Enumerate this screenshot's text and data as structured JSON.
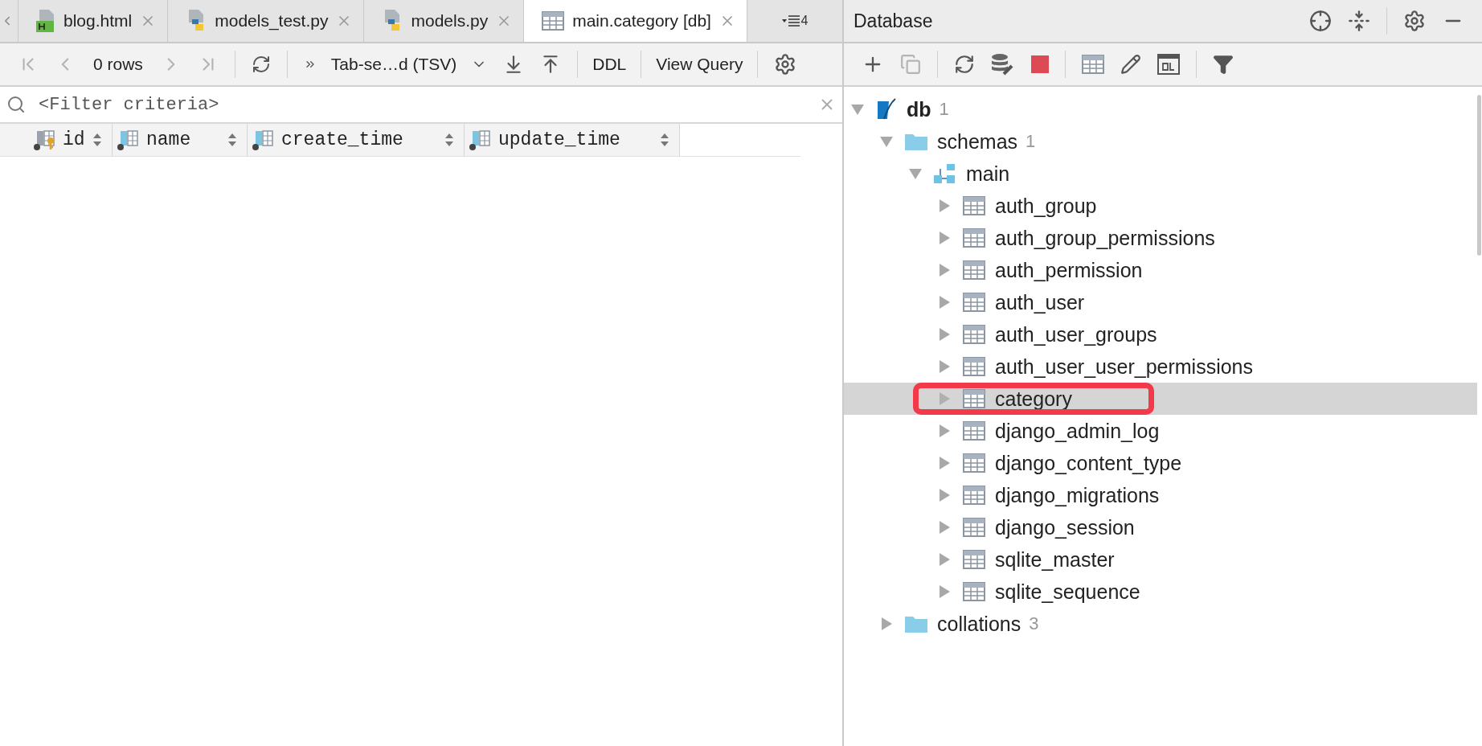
{
  "editor_tabs": [
    {
      "label": "blog.html",
      "kind": "html",
      "selected": false
    },
    {
      "label": "models_test.py",
      "kind": "python",
      "selected": false
    },
    {
      "label": "models.py",
      "kind": "python",
      "selected": false
    },
    {
      "label": "main.category [db]",
      "kind": "table",
      "selected": true
    }
  ],
  "overflow_count": "4",
  "result_toolbar": {
    "rows": "0 rows",
    "format": "Tab-se…d (TSV)",
    "buttons": [
      "DDL",
      "View Query"
    ]
  },
  "filter": {
    "placeholder": "<Filter criteria>"
  },
  "columns": [
    {
      "name": "id",
      "kind": "key"
    },
    {
      "name": "name",
      "kind": "column"
    },
    {
      "name": "create_time",
      "kind": "column"
    },
    {
      "name": "update_time",
      "kind": "column"
    }
  ],
  "database_panel": {
    "title": "Database",
    "tree": [
      {
        "label": "db",
        "count": "1",
        "kind": "database",
        "expanded": true,
        "selected": false,
        "marked": false,
        "children": [
          {
            "label": "schemas",
            "count": "1",
            "kind": "folder",
            "expanded": true,
            "selected": false,
            "marked": false,
            "children": [
              {
                "label": "main",
                "kind": "schema",
                "expanded": true,
                "selected": false,
                "marked": false,
                "children": [
                  {
                    "label": "auth_group",
                    "kind": "table",
                    "expanded": false,
                    "selected": false,
                    "marked": false
                  },
                  {
                    "label": "auth_group_permissions",
                    "kind": "table",
                    "expanded": false,
                    "selected": false,
                    "marked": false
                  },
                  {
                    "label": "auth_permission",
                    "kind": "table",
                    "expanded": false,
                    "selected": false,
                    "marked": false
                  },
                  {
                    "label": "auth_user",
                    "kind": "table",
                    "expanded": false,
                    "selected": false,
                    "marked": false
                  },
                  {
                    "label": "auth_user_groups",
                    "kind": "table",
                    "expanded": false,
                    "selected": false,
                    "marked": false
                  },
                  {
                    "label": "auth_user_user_permissions",
                    "kind": "table",
                    "expanded": false,
                    "selected": false,
                    "marked": false
                  },
                  {
                    "label": "category",
                    "kind": "table",
                    "expanded": false,
                    "selected": true,
                    "marked": true
                  },
                  {
                    "label": "django_admin_log",
                    "kind": "table",
                    "expanded": false,
                    "selected": false,
                    "marked": false
                  },
                  {
                    "label": "django_content_type",
                    "kind": "table",
                    "expanded": false,
                    "selected": false,
                    "marked": false
                  },
                  {
                    "label": "django_migrations",
                    "kind": "table",
                    "expanded": false,
                    "selected": false,
                    "marked": false
                  },
                  {
                    "label": "django_session",
                    "kind": "table",
                    "expanded": false,
                    "selected": false,
                    "marked": false
                  },
                  {
                    "label": "sqlite_master",
                    "kind": "table",
                    "expanded": false,
                    "selected": false,
                    "marked": false
                  },
                  {
                    "label": "sqlite_sequence",
                    "kind": "table",
                    "expanded": false,
                    "selected": false,
                    "marked": false
                  }
                ]
              }
            ]
          },
          {
            "label": "collations",
            "count": "3",
            "kind": "folder",
            "expanded": false,
            "selected": false,
            "marked": false
          }
        ]
      }
    ]
  }
}
